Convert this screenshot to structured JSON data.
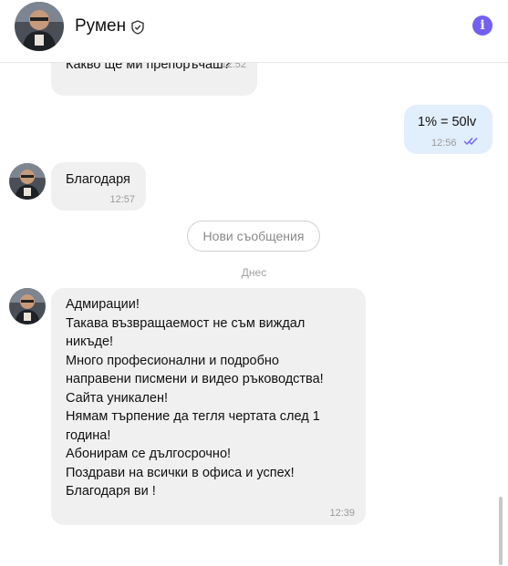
{
  "contact": {
    "name": "Румен",
    "avatar_icon": "user-avatar-photo",
    "verified_icon": "shield-check-icon",
    "info_icon": "info-icon",
    "info_glyph": "i",
    "accent_color": "#7360f2"
  },
  "messages": [
    {
      "direction": "in",
      "text": "Какво ще ми препоръчаш?",
      "time": "12:52"
    },
    {
      "direction": "out",
      "text": "1% = 50lv",
      "time": "12:56",
      "status_icon": "double-check-icon"
    },
    {
      "direction": "in",
      "text": "Благодаря",
      "time": "12:57"
    },
    {
      "direction": "in",
      "lines": [
        "Адмирации!",
        "Такава възвращаемост не съм виждал",
        "никъде!",
        "Много професионални и подробно",
        "направени писмени и видео ръководства!",
        "Сайта уникален!",
        "Нямам търпение да тегля чертата след 1",
        "година!",
        "Абонирам се дългосрочно!",
        "Поздрави на всички в офиса и успех!",
        "Благодаря ви !"
      ],
      "time": "12:39"
    }
  ],
  "new_messages_label": "Нови съобщения",
  "date_separator": "Днес"
}
